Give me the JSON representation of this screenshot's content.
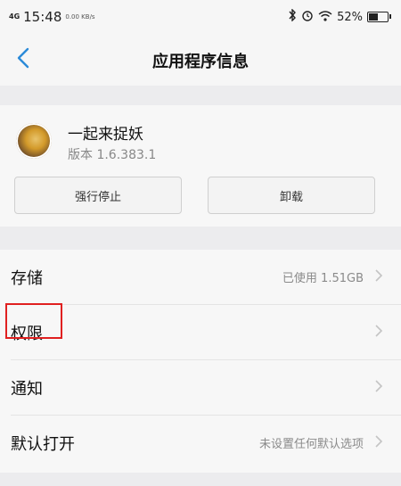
{
  "status_bar": {
    "signal": "4G",
    "time": "15:48",
    "net_speed": "0.00 KB/s",
    "battery_percent_label": "52%",
    "battery_level": 0.52
  },
  "nav": {
    "title": "应用程序信息"
  },
  "app": {
    "name": "一起来捉妖",
    "version": "版本 1.6.383.1"
  },
  "actions": {
    "force_stop": "强行停止",
    "uninstall": "卸载"
  },
  "rows": [
    {
      "label": "存储",
      "value": "已使用 1.51GB"
    },
    {
      "label": "权限",
      "value": ""
    },
    {
      "label": "通知",
      "value": ""
    },
    {
      "label": "默认打开",
      "value": "未设置任何默认选项"
    }
  ],
  "colors": {
    "accent": "#2b8ad8",
    "highlight": "#e02020"
  }
}
